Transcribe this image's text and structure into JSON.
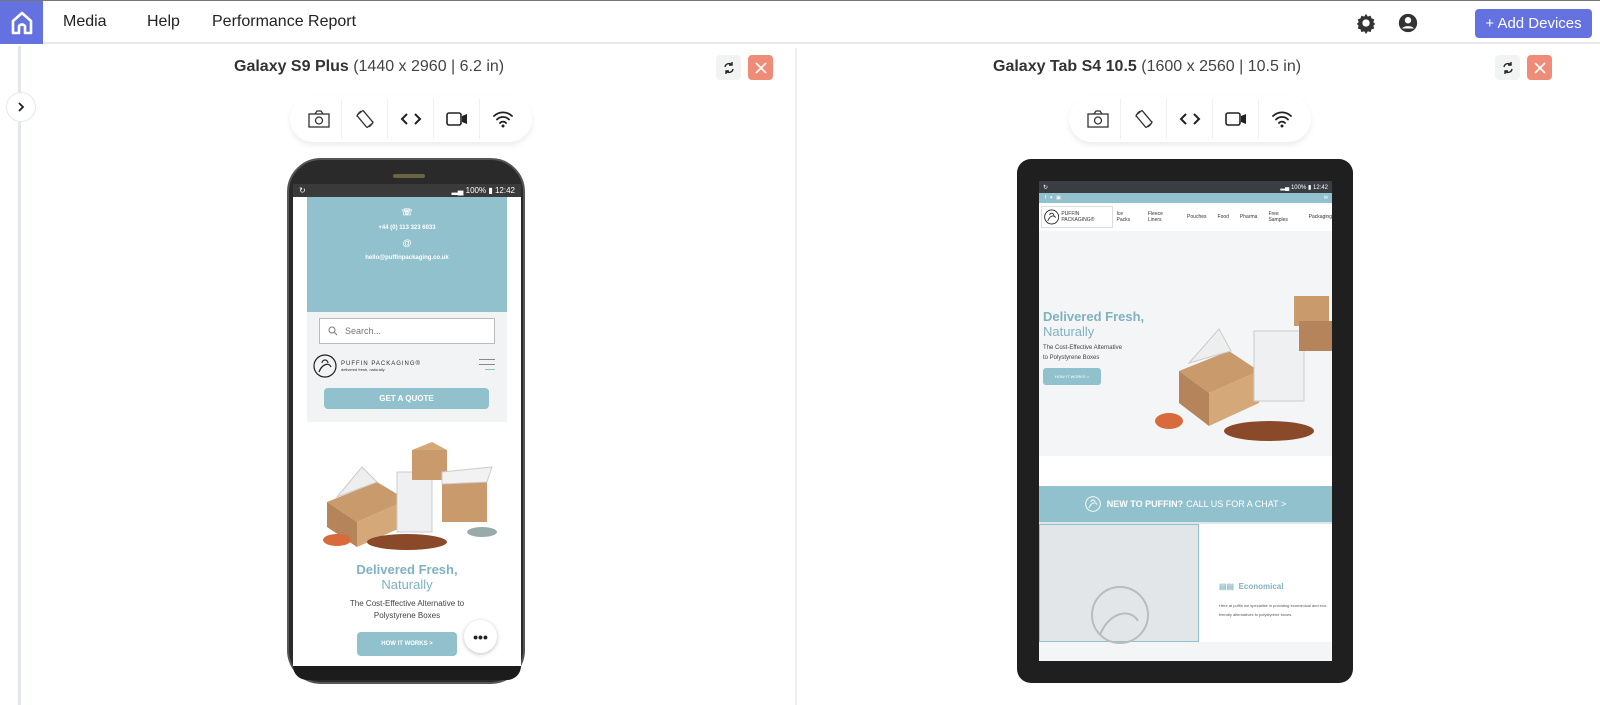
{
  "topbar": {
    "nav": [
      "Media",
      "Help",
      "Performance Report"
    ],
    "add_devices_label": "+ Add Devices",
    "accent_color": "#6471e0"
  },
  "devices": [
    {
      "name": "Galaxy S9 Plus",
      "spec": "(1440 x 2960 | 6.2 in)",
      "status_bar": {
        "battery": "100%",
        "time": "12:42"
      },
      "site": {
        "phone": "+44 (0) 113 323 6033",
        "email": "hello@puffinpackaging.co.uk",
        "search_placeholder": "Search...",
        "brand": "PUFFIN PACKAGING®",
        "tagline": "delivered fresh, naturally",
        "quote_button": "GET A QUOTE",
        "headline_1": "Delivered Fresh,",
        "headline_2": "Naturally",
        "subtitle_1": "The Cost-Effective Alternative to",
        "subtitle_2": "Polystyrene Boxes",
        "how_button": "HOW IT WORKS >"
      }
    },
    {
      "name": "Galaxy Tab S4 10.5",
      "spec": "(1600 x 2560 | 10.5 in)",
      "status_bar": {
        "battery": "100%",
        "time": "12:42"
      },
      "site": {
        "brand": "PUFFIN PACKAGING®",
        "tagline": "delivered fresh, naturally",
        "nav": [
          "Ice Packs",
          "Fleece Liners",
          "Pouches",
          "Food",
          "Pharma",
          "Free Samples",
          "Packaging"
        ],
        "headline_1": "Delivered Fresh,",
        "headline_2": "Naturally",
        "subtitle_1": "The Cost-Effective Alternative",
        "subtitle_2": "to Polystyrene Boxes",
        "how_button": "HOW IT WORKS >",
        "chat_bold": "NEW TO PUFFIN?",
        "chat_text": "CALL US FOR A CHAT >",
        "feature_title": "Economical",
        "feature_text": "Here at puffin we specialise in providing economical and eco-friendly alternatives to polystyrene boxes."
      }
    }
  ],
  "more_label": "•••"
}
